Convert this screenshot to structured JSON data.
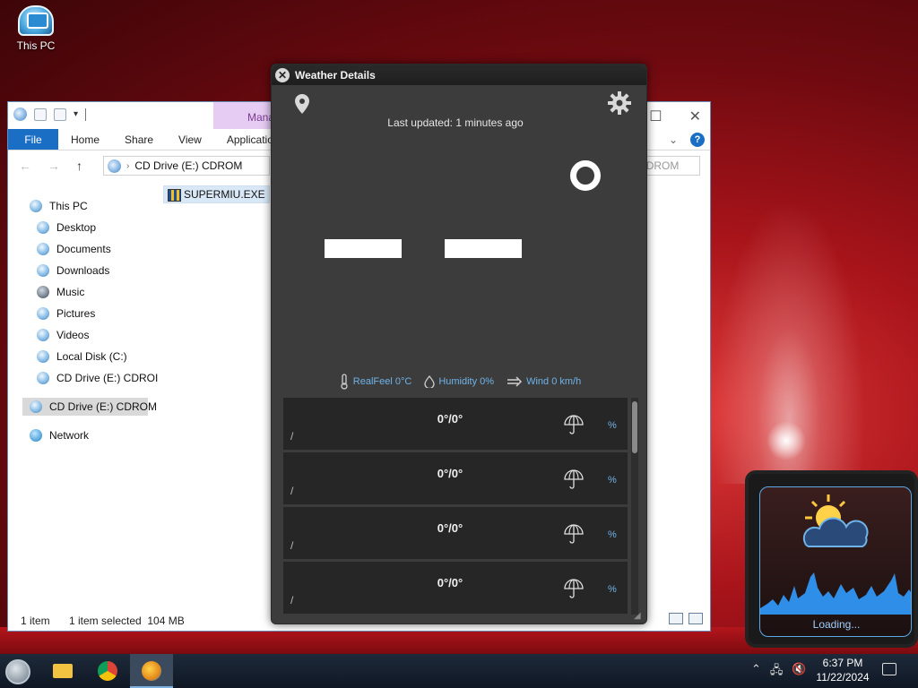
{
  "desktop": {
    "icon_label": "This PC"
  },
  "explorer": {
    "manage_tab": "Manage",
    "window_controls": [
      "–",
      "☐",
      "✕"
    ],
    "ribbon": {
      "file": "File",
      "tabs": [
        "Home",
        "Share",
        "View",
        "Application Tools"
      ]
    },
    "address": {
      "path_root": "CD Drive (E:) CDROM"
    },
    "search": {
      "placeholder": "Search CD Drive (E:) CDROM"
    },
    "nav": {
      "items": [
        {
          "label": "This PC",
          "icon": "this-pc-icon"
        },
        {
          "label": "Desktop",
          "icon": "desktop-icon"
        },
        {
          "label": "Documents",
          "icon": "documents-icon"
        },
        {
          "label": "Downloads",
          "icon": "downloads-icon"
        },
        {
          "label": "Music",
          "icon": "music-icon"
        },
        {
          "label": "Pictures",
          "icon": "pictures-icon"
        },
        {
          "label": "Videos",
          "icon": "videos-icon"
        },
        {
          "label": "Local Disk (C:)",
          "icon": "local-disk-icon"
        },
        {
          "label": "CD Drive (E:) CDROI",
          "icon": "cd-drive-icon"
        },
        {
          "label": "CD Drive (E:) CDROM",
          "icon": "cd-drive-icon"
        },
        {
          "label": "Network",
          "icon": "network-icon"
        }
      ]
    },
    "files": [
      {
        "name": "SUPERMIU.EXE"
      }
    ],
    "status": {
      "count": "1 item",
      "selection": "1 item selected  104 MB"
    }
  },
  "weather": {
    "title": "Weather Details",
    "updated": "Last updated: 1 minutes ago",
    "stats": {
      "realfeel": "RealFeel 0°C",
      "humidity": "Humidity 0%",
      "wind": "Wind 0 km/h"
    },
    "forecast": [
      {
        "temp": "0°/0°",
        "date": "/",
        "precip": "%"
      },
      {
        "temp": "0°/0°",
        "date": "/",
        "precip": "%"
      },
      {
        "temp": "0°/0°",
        "date": "/",
        "precip": "%"
      },
      {
        "temp": "0°/0°",
        "date": "/",
        "precip": "%"
      }
    ],
    "colors": {
      "accent": "#6fb3e8",
      "panel": "#3c3c3c",
      "row": "#262626"
    }
  },
  "gadget": {
    "status": "Loading..."
  },
  "taskbar": {
    "time": "6:37 PM",
    "date": "11/22/2024"
  }
}
